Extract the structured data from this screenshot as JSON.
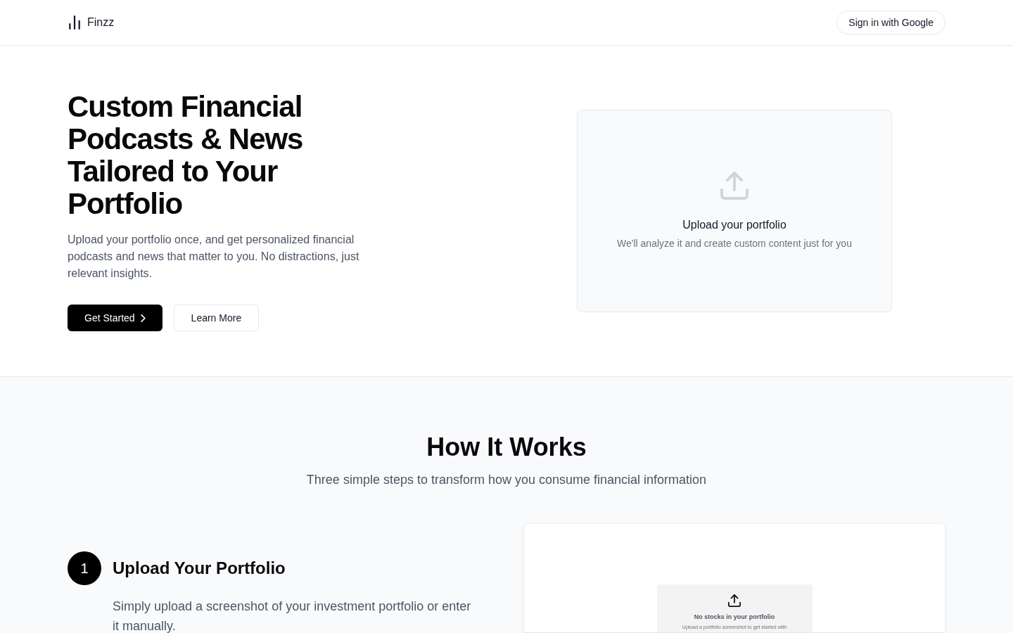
{
  "header": {
    "brand": "Finzz",
    "sign_in_label": "Sign in with Google"
  },
  "hero": {
    "title": "Custom Financial Podcasts & News Tailored to Your Portfolio",
    "description": "Upload your portfolio once, and get personalized financial podcasts and news that matter to you. No distractions, just relevant insights.",
    "buttons": [
      {
        "label": "Get Started",
        "kind": "primary"
      },
      {
        "label": "Learn More",
        "kind": "secondary"
      }
    ],
    "upload_card": {
      "title": "Upload your portfolio",
      "subtitle": "We'll analyze it and create custom content just for you"
    }
  },
  "how_it_works": {
    "title": "How It Works",
    "subtitle": "Three simple steps to transform how you consume financial information",
    "steps": [
      {
        "number": "1",
        "title": "Upload Your Portfolio",
        "description": "Simply upload a screenshot of your investment portfolio or enter it manually."
      }
    ],
    "preview": {
      "title": "No stocks in your portfolio",
      "text": "Upload a portfolio screenshot to get started with"
    }
  }
}
